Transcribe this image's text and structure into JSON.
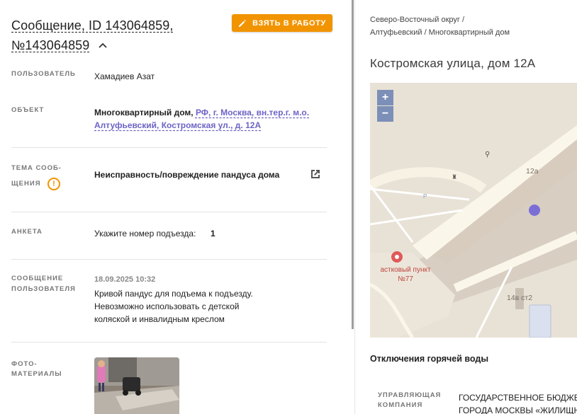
{
  "message": {
    "title_line1": "Сообщение, ID 143064859,",
    "title_line2": "№143064859",
    "take_button": "ВЗЯТЬ В РАБОТУ"
  },
  "fields": {
    "user_label": "ПОЛЬЗОВАТЕЛЬ",
    "user_value": "Хамадиев Азат",
    "object_label": "ОБЪЕКТ",
    "object_type": "Многоквартирный дом,",
    "object_link_line1": "РФ, г. Москва, вн.тер.г. м.о.",
    "object_link_line2": "Алтуфьевский, Костромская ул., д. 12А",
    "topic_label_line1": "ТЕМА СООБ-",
    "topic_label_line2": "ЩЕНИЯ",
    "topic_value": "Неисправность/повреждение пандуса дома",
    "survey_label": "АНКЕТА",
    "survey_question": "Укажите номер подъезда:",
    "survey_answer": "1",
    "msg_label_line1": "СООБЩЕНИЕ",
    "msg_label_line2": "ПОЛЬЗОВАТЕЛЯ",
    "msg_date": "18.09.2025 10:32",
    "msg_line1": "Кривой пандус для подъема к подъезду.",
    "msg_line2": "Невозможно использовать с детской",
    "msg_line3": "коляской и инвалидным креслом",
    "photo_label_line1": "ФОТО-",
    "photo_label_line2": "МАТЕРИАЛЫ"
  },
  "right": {
    "crumb_line1": "Северо-Восточный округ /",
    "crumb_line2": "Алтуфьевский / Многоквартирный дом",
    "address": "Костромская улица, дом 12А",
    "map": {
      "zoom_in": "+",
      "zoom_out": "−",
      "label_12a": "12а",
      "label_14v": "14в ст2",
      "poi_line1": "астковый пункт",
      "poi_line2": "№77",
      "parking": "P"
    },
    "hot_water": "Отключения горячей воды",
    "mc_label_line1": "УПРАВЛЯЮЩАЯ",
    "mc_label_line2": "КОМПАНИЯ",
    "mc_value_line1": "ГОСУДАРСТВЕННОЕ БЮДЖЕ",
    "mc_value_line2": "ГОРОДА МОСКВЫ «ЖИЛИЩН"
  },
  "colors": {
    "accent": "#f29400",
    "link": "#6c63c6",
    "marker": "#7b6fd6",
    "zoom": "#7c8fb8"
  }
}
